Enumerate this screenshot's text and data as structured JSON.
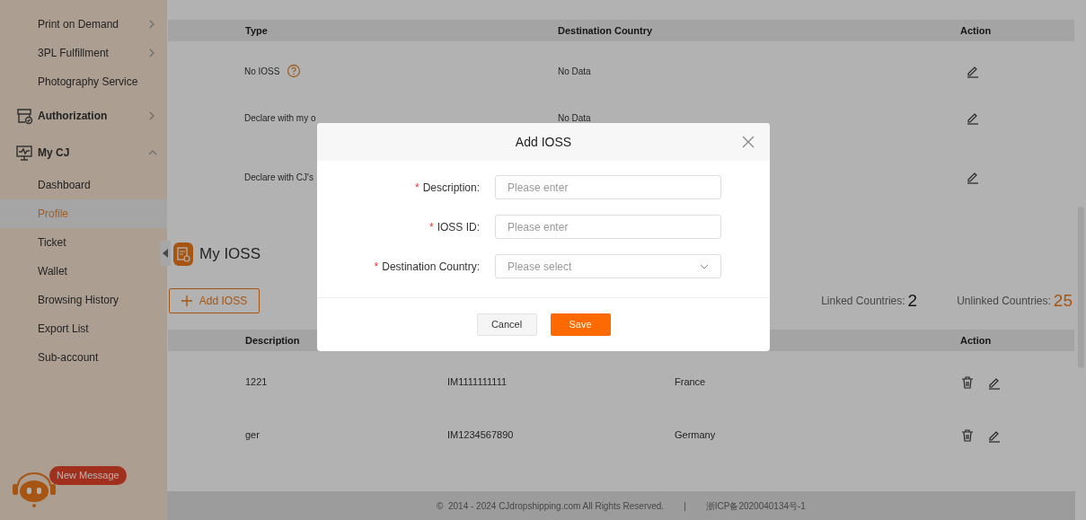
{
  "sidebar": {
    "items": [
      {
        "label": "Print on Demand",
        "kind": "sub",
        "expandable": true
      },
      {
        "label": "3PL Fulfillment",
        "kind": "sub",
        "expandable": true
      },
      {
        "label": "Photography Service",
        "kind": "sub",
        "expandable": false
      },
      {
        "label": "Authorization",
        "kind": "group",
        "expanded": false
      },
      {
        "label": "My CJ",
        "kind": "group",
        "expanded": true,
        "children": [
          {
            "label": "Dashboard",
            "selected": false
          },
          {
            "label": "Profile",
            "selected": true
          },
          {
            "label": "Ticket",
            "selected": false
          },
          {
            "label": "Wallet",
            "selected": false
          },
          {
            "label": "Browsing History",
            "selected": false
          },
          {
            "label": "Export List",
            "selected": false
          },
          {
            "label": "Sub-account",
            "selected": false
          }
        ]
      }
    ],
    "message_badge": "New Message"
  },
  "declaration_table": {
    "columns": [
      "Type",
      "Destination Country",
      "Action"
    ],
    "rows": [
      {
        "type": "No IOSS",
        "help": true,
        "destination": "No Data"
      },
      {
        "type": "Declare with my o",
        "help": false,
        "destination": "No Data"
      },
      {
        "type": "Declare with CJ's",
        "help": false
      }
    ]
  },
  "my_ioss": {
    "title": "My IOSS",
    "add_button": "Add IOSS",
    "linked_label": "Linked Countries:",
    "linked_count": "2",
    "unlinked_label": "Unlinked Countries:",
    "unlinked_count": "25",
    "columns": [
      "Description",
      "Action"
    ],
    "rows": [
      {
        "description": "1221",
        "ioss_id": "IM1111111111",
        "country": "France"
      },
      {
        "description": "ger",
        "ioss_id": "IM1234567890",
        "country": "Germany"
      }
    ]
  },
  "footer": {
    "copyright": "©  2014 - 2024 CJdropshipping.com All Rights Reserved.",
    "separator": "|",
    "icp": "浙ICP备2020040134号-1"
  },
  "dialog": {
    "title": "Add IOSS",
    "fields": [
      {
        "label": "Description:",
        "required_mark": "*",
        "kind": "input",
        "placeholder": "Please enter"
      },
      {
        "label": "IOSS ID:",
        "required_mark": "*",
        "kind": "input",
        "placeholder": "Please enter"
      },
      {
        "label": "Destination Country:",
        "required_mark": "*",
        "kind": "select",
        "placeholder": "Please select"
      }
    ],
    "buttons": [
      {
        "label": "Cancel",
        "kind": "secondary"
      },
      {
        "label": "Save",
        "kind": "primary"
      }
    ]
  }
}
